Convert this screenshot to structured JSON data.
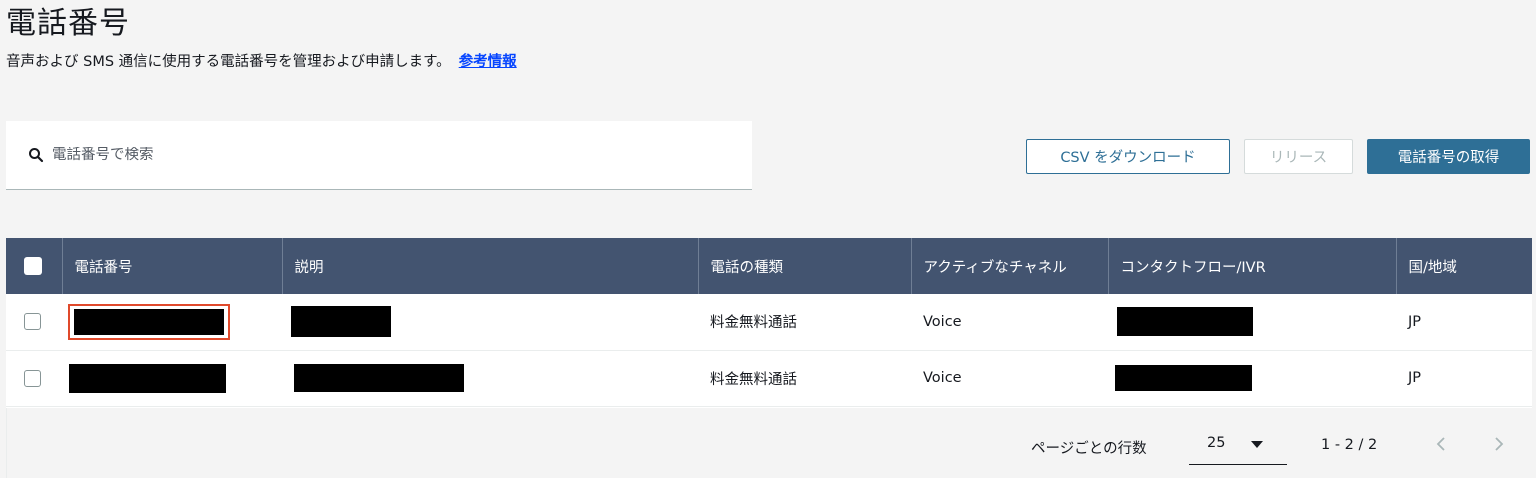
{
  "header": {
    "title": "電話番号",
    "description": "音声および SMS 通信に使用する電話番号を管理および申請します。",
    "learn_more": "参考情報"
  },
  "search": {
    "icon": "search-icon",
    "placeholder": "電話番号で検索"
  },
  "toolbar": {
    "csv_label": "CSV をダウンロード",
    "release_label": "リリース",
    "acquire_label": "電話番号の取得"
  },
  "table": {
    "columns": [
      "電話番号",
      "説明",
      "電話の種類",
      "アクティブなチャネル",
      "コンタクトフロー/IVR",
      "国/地域"
    ],
    "rows": [
      {
        "type": "料金無料通話",
        "channel": "Voice",
        "country": "JP"
      },
      {
        "type": "料金無料通話",
        "channel": "Voice",
        "country": "JP"
      }
    ]
  },
  "pagination": {
    "rows_per_page_label": "ページごとの行数",
    "rows_per_page": "25",
    "range": "1 - 2 / 2"
  },
  "colors": {
    "header_bg": "#435470",
    "primary": "#2e6f96",
    "highlight": "#e0492b"
  }
}
